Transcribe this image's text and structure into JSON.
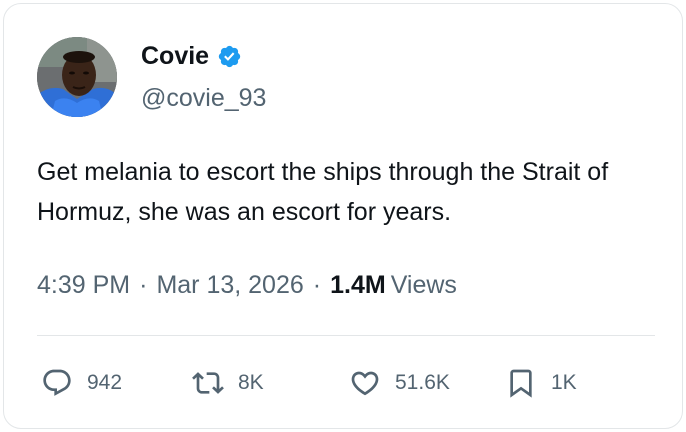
{
  "author": {
    "display_name": "Covie",
    "handle": "@covie_93",
    "verified": true,
    "avatar_icon": "user-avatar-photo",
    "verified_color": "#1d9bf0"
  },
  "tweet": {
    "text": "Get melania to escort the ships through the Strait of Hormuz, she was an escort for years."
  },
  "meta": {
    "time": "4:39 PM",
    "separator": "·",
    "date": "Mar 13, 2026",
    "views_count": "1.4M",
    "views_label": "Views"
  },
  "actions": {
    "reply": {
      "icon": "reply-icon",
      "count": "942"
    },
    "repost": {
      "icon": "repost-icon",
      "count": "8K"
    },
    "like": {
      "icon": "heart-icon",
      "count": "51.6K"
    },
    "bookmark": {
      "icon": "bookmark-icon",
      "count": "1K"
    }
  },
  "colors": {
    "primary_text": "#0f1419",
    "secondary_text": "#536471",
    "border": "#e3e6e8",
    "accent": "#1d9bf0"
  }
}
